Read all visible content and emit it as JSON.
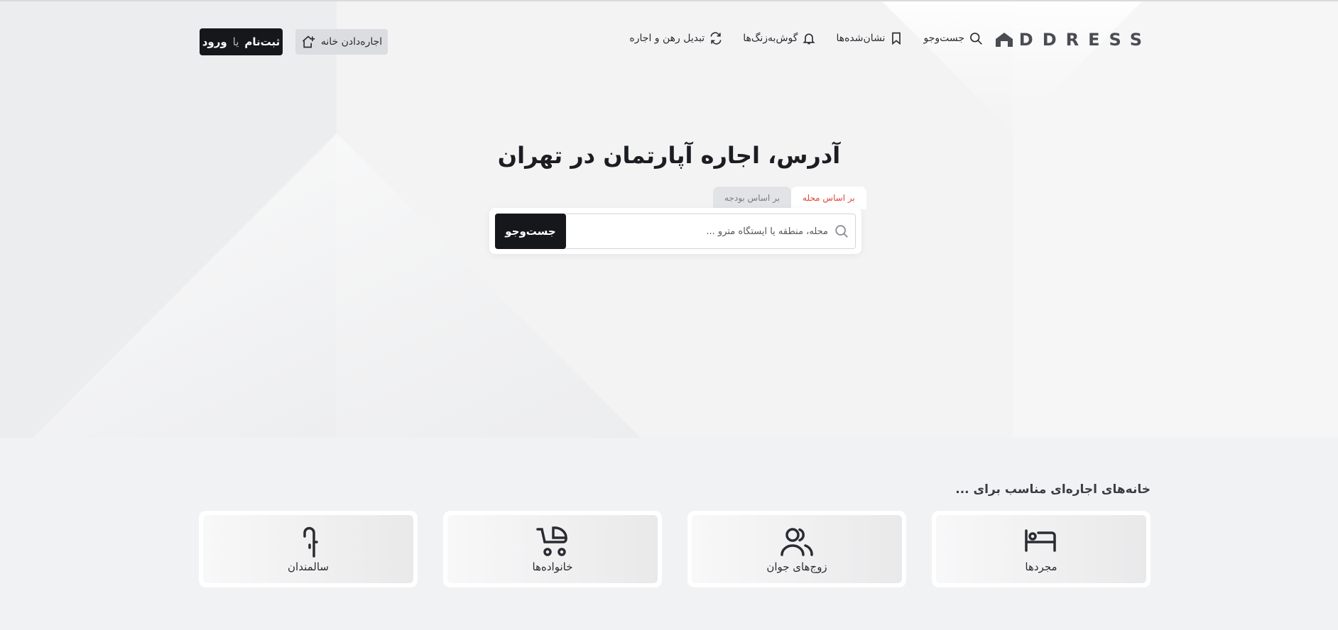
{
  "header": {
    "logo_text": "DDRESS",
    "nav": [
      {
        "label": "جست‌وجو",
        "icon": "search-icon"
      },
      {
        "label": "نشان‌شده‌ها",
        "icon": "bookmark-icon"
      },
      {
        "label": "گوش‌به‌زنگ‌ها",
        "icon": "bell-icon"
      },
      {
        "label": "تبدیل رهن و اجاره",
        "icon": "convert-icon"
      }
    ],
    "rent_button": "اجاره‌دادن خانه",
    "login": {
      "signup": "ثبت‌نام",
      "or": "یا",
      "login": "ورود"
    }
  },
  "hero": {
    "title": "آدرس، اجاره آپارتمان در تهران",
    "tabs": [
      {
        "label": "بر اساس محله",
        "active": true
      },
      {
        "label": "بر اساس بودجه",
        "active": false
      }
    ],
    "search_placeholder": "محله، منطقه یا ایستگاه مترو ...",
    "search_button": "جست‌وجو"
  },
  "suitable": {
    "title": "خانه‌های اجاره‌ای مناسب برای ...",
    "cards": [
      {
        "label": "مجردها",
        "icon": "bed-icon"
      },
      {
        "label": "زوج‌های جوان",
        "icon": "couple-icon"
      },
      {
        "label": "خانواده‌ها",
        "icon": "stroller-icon"
      },
      {
        "label": "سالمندان",
        "icon": "cane-icon"
      }
    ]
  },
  "colors": {
    "accent": "#e0483c",
    "dark": "#15171b",
    "background": "#f1f2f4"
  }
}
